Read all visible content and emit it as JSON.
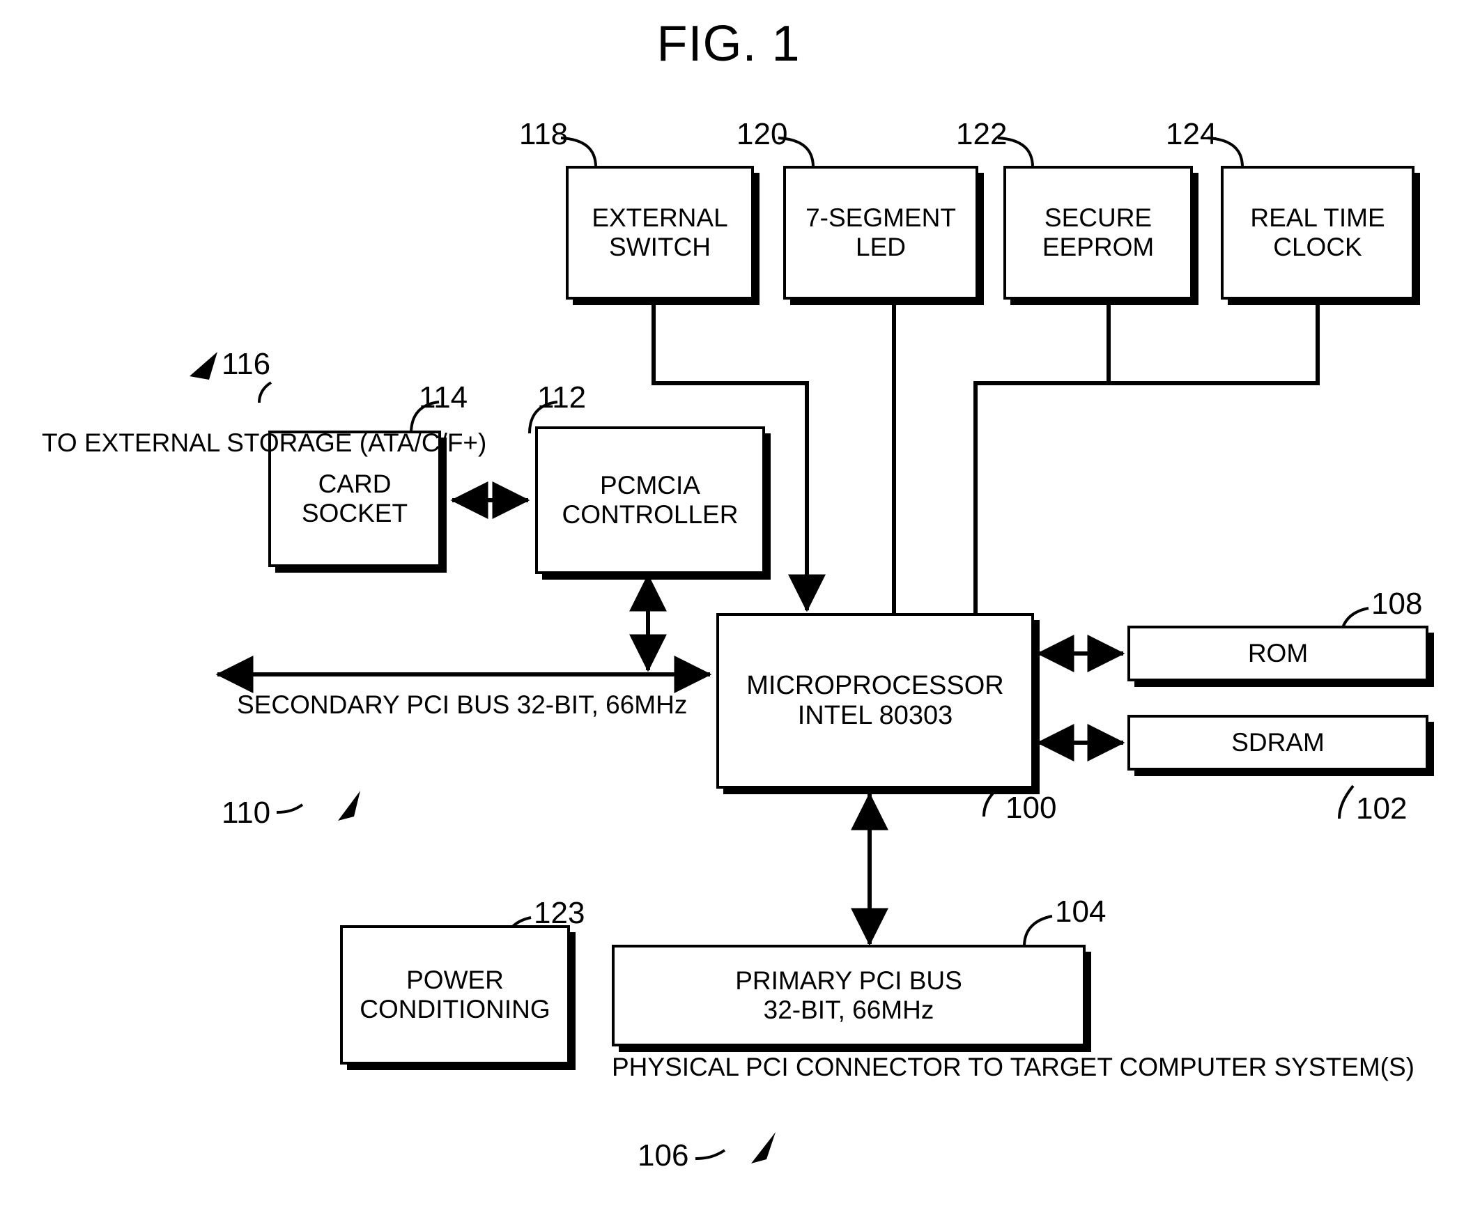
{
  "figure": {
    "title": "FIG. 1"
  },
  "blocks": [
    {
      "id": "external-switch",
      "ref": "118",
      "lines": [
        "EXTERNAL",
        "SWITCH"
      ]
    },
    {
      "id": "seven-segment-led",
      "ref": "120",
      "lines": [
        "7-SEGMENT",
        "LED"
      ]
    },
    {
      "id": "secure-eeprom",
      "ref": "122",
      "lines": [
        "SECURE",
        "EEPROM"
      ]
    },
    {
      "id": "real-time-clock",
      "ref": "124",
      "lines": [
        "REAL TIME",
        "CLOCK"
      ]
    },
    {
      "id": "card-socket",
      "ref": "114",
      "lines": [
        "CARD",
        "SOCKET"
      ]
    },
    {
      "id": "pcmcia-controller",
      "ref": "112",
      "lines": [
        "PCMCIA",
        "CONTROLLER"
      ]
    },
    {
      "id": "microprocessor",
      "ref": "100",
      "lines": [
        "MICROPROCESSOR",
        "INTEL 80303"
      ]
    },
    {
      "id": "rom",
      "ref": "108",
      "lines": [
        "ROM"
      ]
    },
    {
      "id": "sdram",
      "ref": "102",
      "lines": [
        "SDRAM"
      ]
    },
    {
      "id": "power-conditioning",
      "ref": "123",
      "lines": [
        "POWER",
        "CONDITIONING"
      ]
    },
    {
      "id": "primary-pci-bus",
      "ref": "104",
      "lines": [
        "PRIMARY PCI BUS",
        "32-BIT, 66MHz"
      ]
    }
  ],
  "captions": {
    "external_storage": {
      "ref": "116",
      "lines": [
        "TO EXTERNAL",
        "STORAGE",
        "(ATA/C/F+)"
      ]
    },
    "secondary_bus": {
      "ref": "110",
      "lines": [
        "SECONDARY PCI",
        "BUS",
        "32-BIT, 66MHz"
      ]
    },
    "pci_connector": {
      "ref": "106",
      "lines": [
        "PHYSICAL PCI CONNECTOR",
        "TO TARGET COMPUTER",
        "SYSTEM(S)"
      ]
    }
  },
  "refs": {
    "r100": "100",
    "r102": "102",
    "r104": "104",
    "r106": "106",
    "r108": "108",
    "r110": "110",
    "r112": "112",
    "r114": "114",
    "r116": "116",
    "r118": "118",
    "r120": "120",
    "r122": "122",
    "r123": "123",
    "r124": "124"
  },
  "colors": {
    "ink": "#000000",
    "paper": "#ffffff"
  }
}
